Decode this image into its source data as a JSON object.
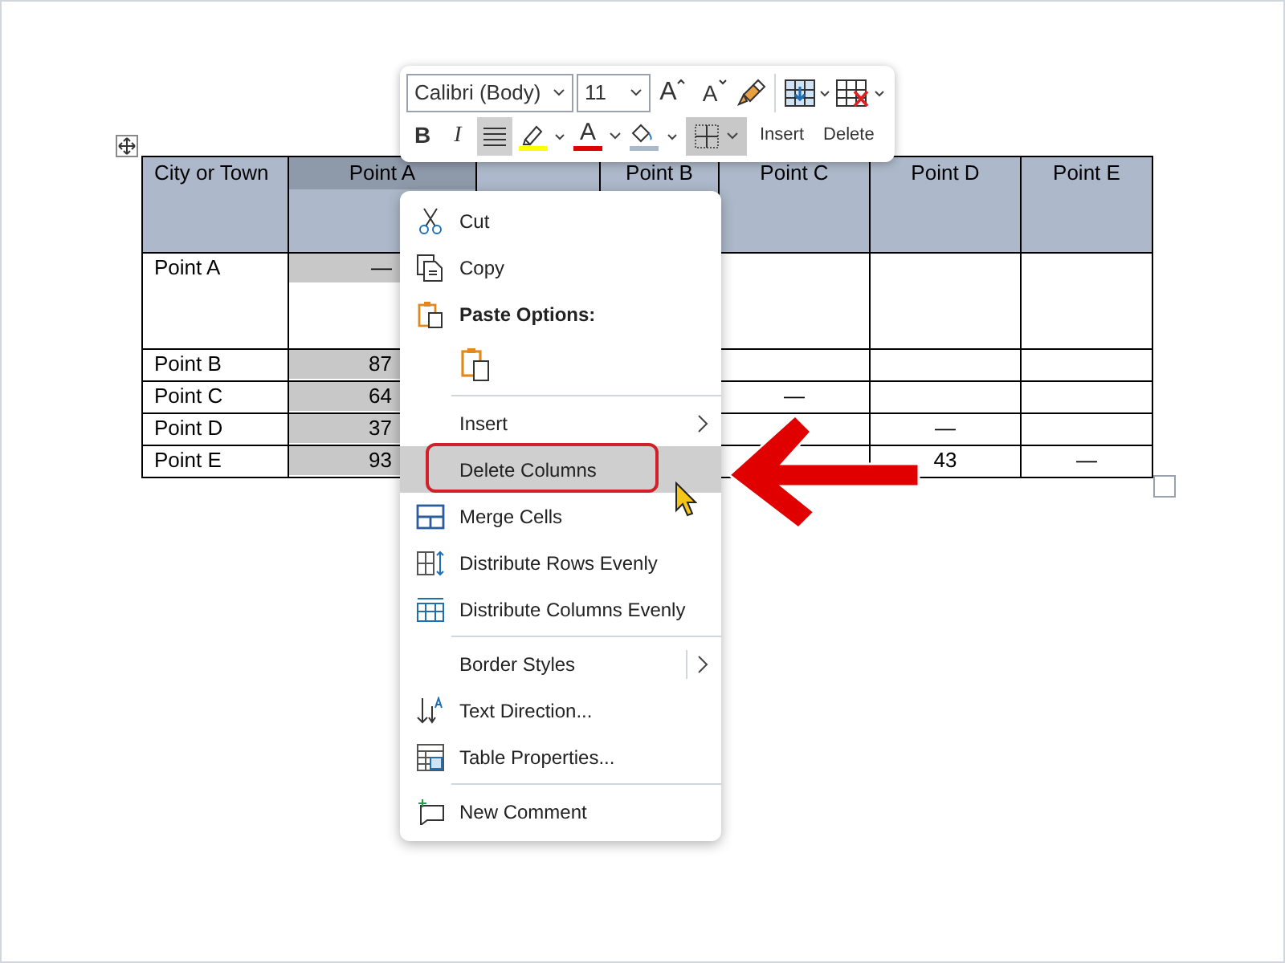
{
  "toolbar": {
    "font": "Calibri (Body)",
    "size": "11",
    "grow_font": "A",
    "shrink_font": "A",
    "bold": "B",
    "italic": "I",
    "font_color": "A",
    "align_selected": true,
    "borders_selected": true,
    "insert_label": "Insert",
    "delete_label": "Delete"
  },
  "table": {
    "columns": [
      {
        "label": "City or Town",
        "selected": false
      },
      {
        "label": "Point A",
        "selected": true
      },
      {
        "selected": false
      },
      {
        "label": "Point B",
        "selected": false
      },
      {
        "label": "Point C",
        "selected": false
      },
      {
        "label": "Point D",
        "selected": false
      },
      {
        "label": "Point E",
        "selected": false
      }
    ],
    "rows": [
      {
        "tall": true,
        "cells": [
          {
            "text": "Point A"
          },
          {
            "text": "—"
          },
          {},
          {},
          {},
          {},
          {}
        ]
      },
      {
        "tall": false,
        "cells": [
          {
            "text": "Point B"
          },
          {
            "text": "87"
          },
          {},
          {},
          {},
          {},
          {}
        ]
      },
      {
        "tall": false,
        "cells": [
          {
            "text": "Point C"
          },
          {
            "text": "64"
          },
          {},
          {},
          {
            "text": "—"
          },
          {},
          {}
        ]
      },
      {
        "tall": false,
        "cells": [
          {
            "text": "Point D"
          },
          {
            "text": "37"
          },
          {},
          {},
          {},
          {
            "text": "—"
          },
          {}
        ]
      },
      {
        "tall": false,
        "cells": [
          {
            "text": "Point E"
          },
          {
            "text": "93"
          },
          {},
          {},
          {},
          {
            "text": "43"
          },
          {
            "text": "—"
          }
        ]
      }
    ]
  },
  "context_menu": [
    {
      "kind": "item",
      "label": "Cut",
      "selected": false
    },
    {
      "kind": "item",
      "label": "Copy",
      "selected": false
    },
    {
      "kind": "header",
      "label": "Paste Options:"
    },
    {
      "kind": "paste"
    },
    {
      "kind": "item",
      "label": "Insert",
      "submenu": true,
      "separator_before": true,
      "selected": false
    },
    {
      "kind": "item",
      "label": "Delete Columns",
      "selected": true,
      "outlined": true
    },
    {
      "kind": "item",
      "label": "Merge Cells",
      "selected": false
    },
    {
      "kind": "item",
      "label": "Distribute Rows Evenly",
      "selected": false
    },
    {
      "kind": "item",
      "label": "Distribute Columns Evenly",
      "selected": false
    },
    {
      "kind": "item",
      "label": "Border Styles",
      "submenu": true,
      "submenu_divider": true,
      "separator_before": true,
      "selected": false
    },
    {
      "kind": "item",
      "label": "Text Direction...",
      "selected": false
    },
    {
      "kind": "item",
      "label": "Table Properties...",
      "selected": false
    },
    {
      "kind": "item",
      "label": "New Comment",
      "separator_before": true,
      "selected": false
    }
  ]
}
